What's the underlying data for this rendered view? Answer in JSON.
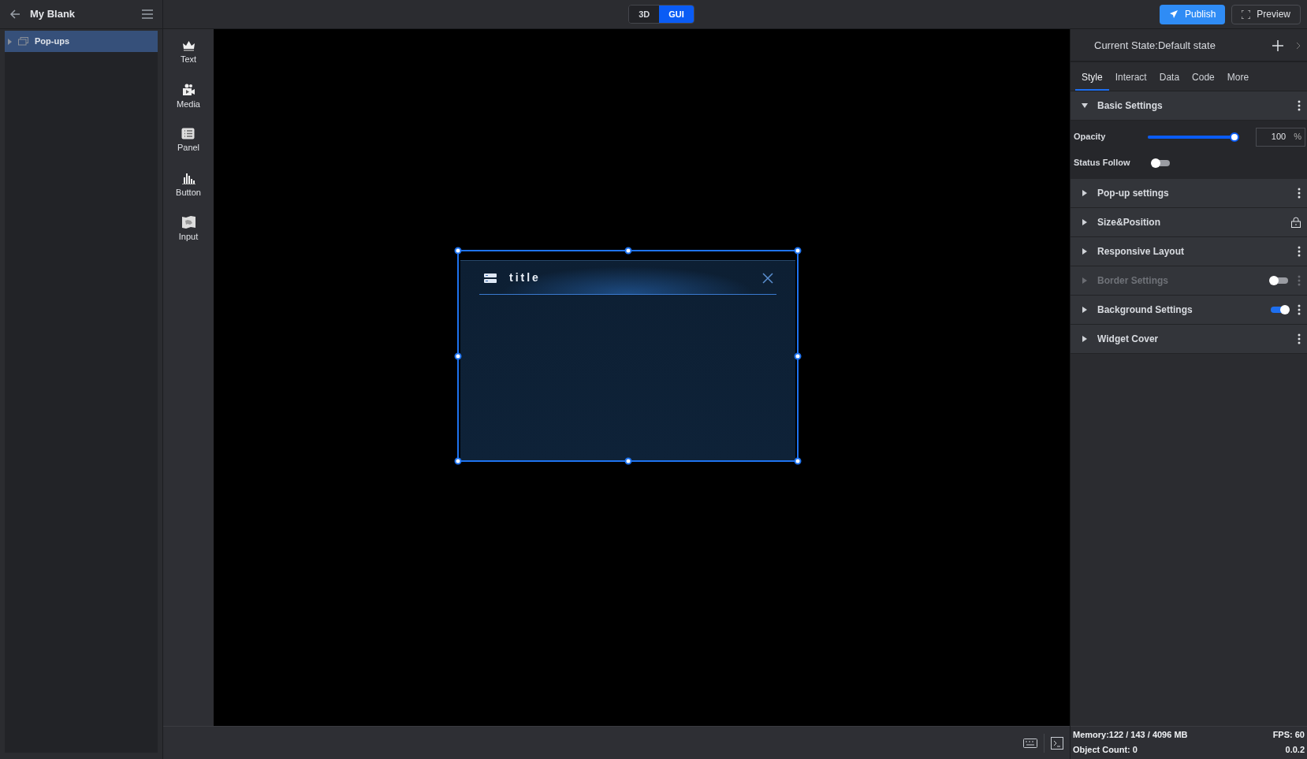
{
  "header": {
    "project_name": "My Blank"
  },
  "mode_toggle": [
    {
      "label": "3D",
      "selected": false
    },
    {
      "label": "GUI",
      "selected": true
    }
  ],
  "actions": [
    {
      "label": "Publish",
      "kind": "primary"
    },
    {
      "label": "Preview",
      "kind": "outline"
    }
  ],
  "layer_tree": [
    {
      "label": "Pop-ups",
      "selected": true,
      "expanded": false
    }
  ],
  "widget_palette": [
    {
      "label": "Text",
      "kind": "text"
    },
    {
      "label": "Media",
      "kind": "media"
    },
    {
      "label": "Panel",
      "kind": "panel"
    },
    {
      "label": "Button",
      "kind": "button"
    },
    {
      "label": "Input",
      "kind": "input"
    }
  ],
  "canvas": {
    "popup": {
      "title": "title",
      "selected": true
    }
  },
  "properties": {
    "current_state": "Current State:Default state",
    "tabs": [
      {
        "label": "Style",
        "selected": true
      },
      {
        "label": "Interact",
        "selected": false
      },
      {
        "label": "Data",
        "selected": false
      },
      {
        "label": "Code",
        "selected": false
      },
      {
        "label": "More",
        "selected": false
      }
    ],
    "sections": [
      {
        "title": "Basic Settings",
        "expanded": true,
        "disabled": false,
        "kind": "menu",
        "fields": [
          {
            "kind": "slider",
            "label": "Opacity",
            "level": 1.0,
            "value": "100",
            "unit": "%"
          },
          {
            "kind": "toggle",
            "label": "Status Follow",
            "on": false
          }
        ]
      },
      {
        "title": "Pop-up settings",
        "expanded": false,
        "disabled": false,
        "kind": "menu"
      },
      {
        "title": "Size&Position",
        "expanded": false,
        "disabled": false,
        "kind": "lock"
      },
      {
        "title": "Responsive Layout",
        "expanded": false,
        "disabled": false,
        "kind": "menu"
      },
      {
        "title": "Border Settings",
        "expanded": false,
        "disabled": true,
        "kind": "menu",
        "toggle": {
          "on": false
        }
      },
      {
        "title": "Background Settings",
        "expanded": false,
        "disabled": false,
        "kind": "menu",
        "toggle": {
          "on": true
        }
      },
      {
        "title": "Widget Cover",
        "expanded": false,
        "disabled": false,
        "kind": "menu"
      }
    ]
  },
  "status_bar": {
    "memory": "Memory:122 / 143 / 4096 MB",
    "fps": "FPS: 60",
    "object_count": "Object Count: 0",
    "version": "0.0.2"
  }
}
